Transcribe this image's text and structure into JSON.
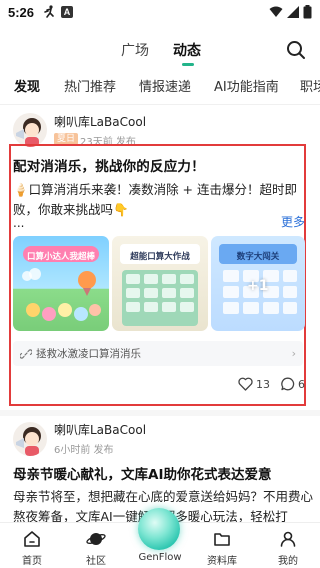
{
  "status": {
    "time": "5:26"
  },
  "topnav": {
    "tab1": "广场",
    "tab2": "动态"
  },
  "categories": [
    "发现",
    "热门推荐",
    "情报速递",
    "AI功能指南",
    "职场"
  ],
  "post1": {
    "author": "喇叭库LaBaCool",
    "tag": "夏日",
    "time": "23天前 发布",
    "title": "配对消消乐，挑战你的反应力！",
    "text": "🍦口算消消乐来袭！凑数消除 + 连击爆分！超时即败，你敢来挑战吗👇",
    "ellipsis": "...",
    "more": "更多",
    "thumbs": [
      {
        "caption": "口算小达人我超棒"
      },
      {
        "caption": "超能口算大作战"
      },
      {
        "caption": "数字大闯关",
        "badge": "+1"
      }
    ],
    "link": "拯救冰激凌口算消消乐",
    "likes": "13",
    "comments": "6"
  },
  "post2": {
    "author": "喇叭库LaBaCool",
    "time": "6小时前 发布",
    "title": "母亲节暖心献礼，文库AI助你花式表达爱意",
    "text": "母亲节将至，想把藏在心底的爱意送给妈妈？不用费心熬夜筹备，文库AI一键解锁超多暖心玩法，轻松打"
  },
  "bottomnav": {
    "home": "首页",
    "community": "社区",
    "genflow": "GenFlow",
    "library": "资料库",
    "me": "我的"
  },
  "colors": {
    "accent": "#22b48a",
    "highlight": "#e23b3b",
    "link": "#2a6fd8"
  }
}
